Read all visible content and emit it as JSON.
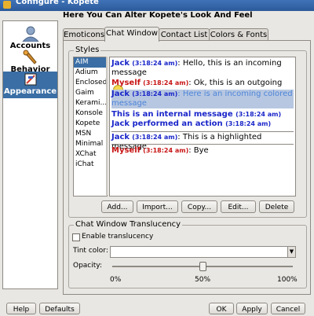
{
  "window": {
    "title": "Configure - Kopete"
  },
  "sidebar": {
    "items": [
      {
        "label": "Accounts",
        "selected": false
      },
      {
        "label": "Behavior",
        "selected": false
      },
      {
        "label": "Appearance",
        "selected": true
      }
    ]
  },
  "page": {
    "heading": "Here You Can Alter Kopete's Look And Feel"
  },
  "tabs": [
    {
      "label": "Emoticons",
      "active": false
    },
    {
      "label": "Chat Window",
      "active": true
    },
    {
      "label": "Contact List",
      "active": false
    },
    {
      "label": "Colors & Fonts",
      "active": false
    }
  ],
  "styles": {
    "group_title": "Styles",
    "list": [
      "AIM",
      "Adium",
      "Enclosed",
      "Gaim",
      "Kerami...",
      "Konsole",
      "Kopete",
      "MSN",
      "Minimal",
      "XChat",
      "iChat"
    ],
    "selected": "AIM",
    "buttons": [
      "Add...",
      "Import...",
      "Copy...",
      "Edit...",
      "Delete"
    ]
  },
  "preview": {
    "messages": [
      {
        "nick": "Jack",
        "time": "(3:18:24 am)",
        "text": ": Hello, this is an incoming message"
      },
      {
        "nick": "Myself",
        "time": "(3:18:24 am)",
        "text": ": Ok, this is an outgoing message"
      },
      {
        "nick": "Jack",
        "time": "(3:18:24 am)",
        "text": ": Here is an incoming colored message"
      },
      {
        "text": "This is an internal message",
        "time": "(3:18:24 am)"
      },
      {
        "text": "Jack performed an action",
        "time": "(3:18:24 am)"
      },
      {
        "nick": "Jack",
        "time": "(3:18:24 am)",
        "text": ": This is a highlighted message"
      },
      {
        "nick": "Myself",
        "time": "(3:18:24 am)",
        "text": ": Bye"
      }
    ]
  },
  "translucency": {
    "group_title": "Chat Window Translucency",
    "checkbox_label": "Enable translucency",
    "checked": false,
    "tint_label": "Tint color:",
    "opacity_label": "Opacity:",
    "opacity_value": 0.5,
    "ticks": [
      "0%",
      "50%",
      "100%"
    ]
  },
  "footer": {
    "help": "Help",
    "defaults": "Defaults",
    "ok": "OK",
    "apply": "Apply",
    "cancel": "Cancel"
  },
  "colors": {
    "selection": "#3a6ea5",
    "incoming_nick": "#1a26c9",
    "outgoing_nick": "#c81414",
    "colored_message": "#4c84d8",
    "highlight_bg": "#b7c7e1"
  }
}
